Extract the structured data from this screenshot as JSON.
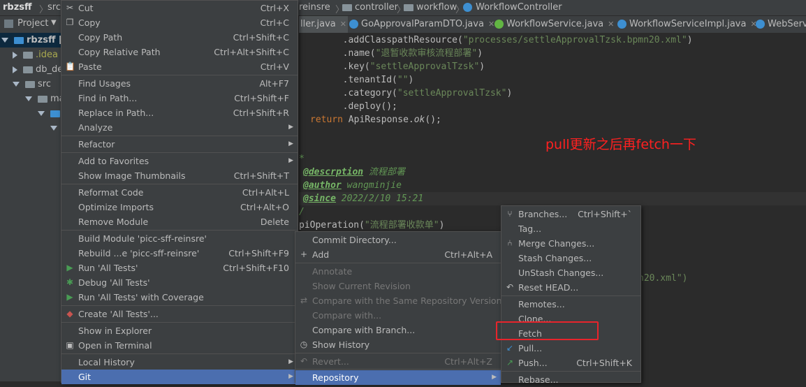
{
  "breadcrumb": {
    "project": "rbzsff",
    "src": "src",
    "module_tail": "reinsre",
    "controller": "controller",
    "workflow": "workflow",
    "class": "WorkflowController"
  },
  "project_panel": {
    "title": "Project",
    "items": [
      {
        "label": "rbzsff [pi"
      },
      {
        "label": ".idea"
      },
      {
        "label": "db_de"
      },
      {
        "label": "src"
      },
      {
        "label": "ma"
      },
      {
        "label": ""
      },
      {
        "label": ""
      }
    ]
  },
  "tabs": [
    {
      "label": "ller.java"
    },
    {
      "label": "GoApprovalParamDTO.java"
    },
    {
      "label": "WorkflowService.java"
    },
    {
      "label": "WorkflowServiceImpl.java"
    },
    {
      "label": "WebServ"
    }
  ],
  "code": {
    "l1_pre": "        .addClasspathResource(",
    "l1_str": "\"processes/settleApprovalTzsk.bpmn20.xml\"",
    "l1_post": ")",
    "l2_pre": "        .name(",
    "l2_str": "\"退暂收款审核流程部署\"",
    "l2_post": ")",
    "l3_pre": "        .key(",
    "l3_str": "\"settleApprovalTzsk\"",
    "l3_post": ")",
    "l4_pre": "        .tenantId(",
    "l4_str": "\"\"",
    "l4_post": ")",
    "l5_pre": "        .category(",
    "l5_str": "\"settleApprovalTzsk\"",
    "l5_post": ")",
    "l6": "        .deploy();",
    "l7_kw": "return ",
    "l7_a": "ApiResponse.",
    "l7_b": "ok",
    "l7_c": "();",
    "c1": "*",
    "c2_tag": "@descrption",
    "c2_txt": " 流程部署",
    "c3_tag": "@author",
    "c3_txt": " wangminjie",
    "c4_tag": "@since",
    "c4_txt": " 2022/2/10 15:21",
    "c5": "/",
    "c6_a": "piOperation(",
    "c6_str": "\"流程部署收款单\"",
    "c6_b": ")",
    "c7": "n20.xml\")",
    "annotation": "pull更新之后再fetch一下"
  },
  "context_menu": [
    {
      "label": "Cut",
      "shortcut": "Ctrl+X",
      "icon": "scissors-icon",
      "glyph": "✂"
    },
    {
      "label": "Copy",
      "shortcut": "Ctrl+C",
      "icon": "copy-icon",
      "glyph": "❐"
    },
    {
      "label": "Copy Path",
      "shortcut": "Ctrl+Shift+C"
    },
    {
      "label": "Copy Relative Path",
      "shortcut": "Ctrl+Alt+Shift+C"
    },
    {
      "label": "Paste",
      "shortcut": "Ctrl+V",
      "icon": "paste-icon",
      "glyph": "📋"
    },
    {
      "label": "Find Usages",
      "shortcut": "Alt+F7"
    },
    {
      "label": "Find in Path...",
      "shortcut": "Ctrl+Shift+F"
    },
    {
      "label": "Replace in Path...",
      "shortcut": "Ctrl+Shift+R"
    },
    {
      "label": "Analyze",
      "submenu": true
    },
    {
      "label": "Refactor",
      "submenu": true
    },
    {
      "label": "Add to Favorites",
      "submenu": true
    },
    {
      "label": "Show Image Thumbnails",
      "shortcut": "Ctrl+Shift+T"
    },
    {
      "label": "Reformat Code",
      "shortcut": "Ctrl+Alt+L"
    },
    {
      "label": "Optimize Imports",
      "shortcut": "Ctrl+Alt+O"
    },
    {
      "label": "Remove Module",
      "shortcut": "Delete"
    },
    {
      "label": "Build Module 'picc-sff-reinsre'"
    },
    {
      "label": "Rebuild ...e 'picc-sff-reinsre'",
      "shortcut": "Ctrl+Shift+F9"
    },
    {
      "label": "Run 'All Tests'",
      "shortcut": "Ctrl+Shift+F10",
      "icon": "run-icon",
      "glyph": "▶",
      "color": "#499c54"
    },
    {
      "label": "Debug 'All Tests'",
      "icon": "debug-icon",
      "glyph": "✱",
      "color": "#499c54"
    },
    {
      "label": "Run 'All Tests' with Coverage",
      "icon": "coverage-icon",
      "glyph": "▶",
      "color": "#499c54"
    },
    {
      "label": "Create 'All Tests'...",
      "icon": "create-config-icon",
      "glyph": "◆",
      "color": "#c75450"
    },
    {
      "label": "Show in Explorer"
    },
    {
      "label": "Open in Terminal",
      "icon": "terminal-icon",
      "glyph": "▣"
    },
    {
      "label": "Local History",
      "submenu": true
    },
    {
      "label": "Git",
      "submenu": true,
      "selected": true
    }
  ],
  "git_menu": [
    {
      "label": "Commit Directory..."
    },
    {
      "label": "Add",
      "shortcut": "Ctrl+Alt+A",
      "icon": "plus-icon",
      "glyph": "+"
    },
    {
      "label": "Annotate",
      "disabled": true
    },
    {
      "label": "Show Current Revision",
      "disabled": true
    },
    {
      "label": "Compare with the Same Repository Version",
      "disabled": true,
      "icon": "compare-icon",
      "glyph": "⇄"
    },
    {
      "label": "Compare with...",
      "disabled": true
    },
    {
      "label": "Compare with Branch..."
    },
    {
      "label": "Show History",
      "icon": "history-icon",
      "glyph": "◷"
    },
    {
      "label": "Revert...",
      "shortcut": "Ctrl+Alt+Z",
      "disabled": true,
      "icon": "revert-icon",
      "glyph": "↶"
    },
    {
      "label": "Repository",
      "submenu": true,
      "selected": true
    }
  ],
  "repo_menu": [
    {
      "label": "Branches...",
      "shortcut": "Ctrl+Shift+`",
      "icon": "branch-icon",
      "glyph": "⑂"
    },
    {
      "label": "Tag..."
    },
    {
      "label": "Merge Changes...",
      "icon": "merge-icon",
      "glyph": "⑃"
    },
    {
      "label": "Stash Changes..."
    },
    {
      "label": "UnStash Changes..."
    },
    {
      "label": "Reset HEAD...",
      "icon": "reset-icon",
      "glyph": "↶"
    },
    {
      "label": "Remotes..."
    },
    {
      "label": "Clone..."
    },
    {
      "label": "Fetch"
    },
    {
      "label": "Pull...",
      "icon": "pull-icon",
      "glyph": "↙",
      "color": "#3d8fd1"
    },
    {
      "label": "Push...",
      "shortcut": "Ctrl+Shift+K",
      "icon": "push-icon",
      "glyph": "↗",
      "color": "#499c54"
    },
    {
      "label": "Rebase..."
    }
  ]
}
